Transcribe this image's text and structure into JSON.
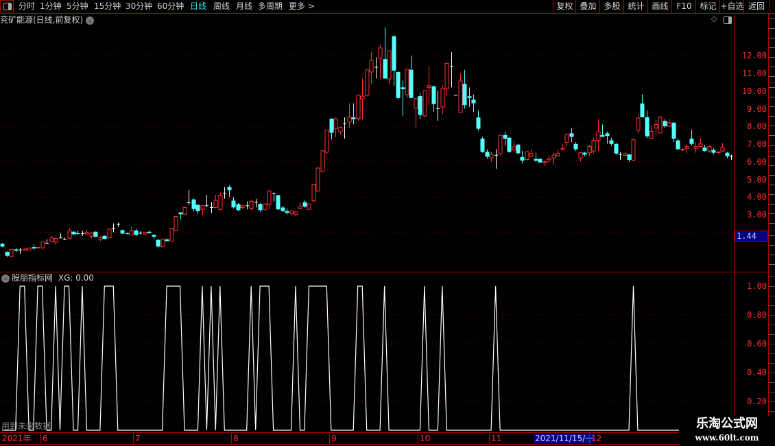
{
  "toolbar": {
    "periods": [
      "分时",
      "1分钟",
      "5分钟",
      "15分钟",
      "30分钟",
      "60分钟",
      "日线",
      "周线",
      "月线",
      "多周期",
      "更多 >"
    ],
    "active_period": "日线",
    "buttons": [
      "复权",
      "叠加",
      "多股",
      "统计",
      "画线",
      "F10",
      "标记",
      "+自选",
      "返回"
    ]
  },
  "main_chart": {
    "title": "兖矿能源(日线,前复权)",
    "price_ticks": [
      "12.00",
      "11.00",
      "10.00",
      "9.00",
      "8.00",
      "7.00",
      "6.00",
      "5.00",
      "4.00",
      "3.00"
    ],
    "crosshair_value": "1.44"
  },
  "indicator_panel": {
    "title": "股朋指标网",
    "value_label": "XG: 0.00",
    "ticks": [
      "1.00",
      "0.80",
      "0.60",
      "0.40",
      "0.20"
    ],
    "future_data_note": "用到未来数据"
  },
  "date_axis": {
    "year_label": "2021年",
    "months": [
      "6",
      "7",
      "8",
      "9",
      "10",
      "11",
      "12"
    ],
    "highlighted_date": "2021/11/15/一"
  },
  "watermark": {
    "title": "乐淘公式网",
    "url": "www.60lt.com"
  },
  "colors": {
    "up": "#ff3232",
    "down": "#54ffff",
    "doji": "#ffffff",
    "axis": "#b00000",
    "signal": "#ffffff",
    "active_tab": "#33e0f0"
  },
  "chart_data": [
    {
      "type": "candlestick",
      "title": "兖矿能源(日线,前复权)",
      "ylim": [
        0.5,
        13.6
      ],
      "grid": "dotted every 2.00",
      "ohlc_fields": [
        "open",
        "high",
        "low",
        "close"
      ],
      "ohlc": [
        [
          1.34,
          1.4,
          1.15,
          1.19
        ],
        [
          0.89,
          0.92,
          0.6,
          0.67
        ],
        [
          0.63,
          1.05,
          0.6,
          1.02
        ],
        [
          1.03,
          1.1,
          0.9,
          0.95
        ],
        [
          1.0,
          1.12,
          0.78,
          1.0
        ],
        [
          1.0,
          1.08,
          0.98,
          1.05
        ],
        [
          0.98,
          1.15,
          0.96,
          1.1
        ],
        [
          1.16,
          1.3,
          1.02,
          1.08
        ],
        [
          1.13,
          1.16,
          1.08,
          1.15
        ],
        [
          1.12,
          1.47,
          1.0,
          1.45
        ],
        [
          1.38,
          1.6,
          1.36,
          1.38
        ],
        [
          1.47,
          1.8,
          1.45,
          1.68
        ],
        [
          1.44,
          1.68,
          1.3,
          1.65
        ],
        [
          1.68,
          1.95,
          1.66,
          1.68
        ],
        [
          1.6,
          1.7,
          1.55,
          1.6
        ],
        [
          1.66,
          2.25,
          1.6,
          2.09
        ],
        [
          2.03,
          2.06,
          1.86,
          1.88
        ],
        [
          1.95,
          2.1,
          1.85,
          1.9
        ],
        [
          1.93,
          2.08,
          1.78,
          1.93
        ],
        [
          1.9,
          2.15,
          1.88,
          2.0
        ],
        [
          1.78,
          2.0,
          1.65,
          1.95
        ],
        [
          2.03,
          2.05,
          1.72,
          1.75
        ],
        [
          1.6,
          1.78,
          1.5,
          1.7
        ],
        [
          1.8,
          1.82,
          1.6,
          1.63
        ],
        [
          1.69,
          2.22,
          1.66,
          2.18
        ],
        [
          2.2,
          2.5,
          2.0,
          2.2
        ],
        [
          2.45,
          2.55,
          2.3,
          2.45
        ],
        [
          2.12,
          2.15,
          1.9,
          1.93
        ],
        [
          1.95,
          1.98,
          1.88,
          1.9
        ],
        [
          1.84,
          2.3,
          1.82,
          2.08
        ],
        [
          2.1,
          2.2,
          1.8,
          1.85
        ],
        [
          1.95,
          2.05,
          1.88,
          1.95
        ],
        [
          1.9,
          2.02,
          1.88,
          1.98
        ],
        [
          2.03,
          2.1,
          1.93,
          1.95
        ],
        [
          1.85,
          1.9,
          1.62,
          1.75
        ],
        [
          1.57,
          1.62,
          1.12,
          1.19
        ],
        [
          1.18,
          1.66,
          1.16,
          1.62
        ],
        [
          1.6,
          1.62,
          1.48,
          1.5
        ],
        [
          1.5,
          2.25,
          1.45,
          2.2
        ],
        [
          2.09,
          2.92,
          2.07,
          2.89
        ],
        [
          3.12,
          3.14,
          2.75,
          3.02
        ],
        [
          3.02,
          3.45,
          3.0,
          3.4
        ],
        [
          3.67,
          4.4,
          3.55,
          3.67
        ],
        [
          3.86,
          3.92,
          3.2,
          3.32
        ],
        [
          3.55,
          3.6,
          3.05,
          3.2
        ],
        [
          3.3,
          3.55,
          2.95,
          3.5
        ],
        [
          3.5,
          4.1,
          3.45,
          3.5
        ],
        [
          3.4,
          3.7,
          3.1,
          3.4
        ],
        [
          3.4,
          4.1,
          3.35,
          3.8
        ],
        [
          3.29,
          4.25,
          3.25,
          4.09
        ],
        [
          4.2,
          4.55,
          3.9,
          4.2
        ],
        [
          4.56,
          4.65,
          4.0,
          4.38
        ],
        [
          3.79,
          4.0,
          3.35,
          3.41
        ],
        [
          3.6,
          3.65,
          3.2,
          3.25
        ],
        [
          3.4,
          3.55,
          3.3,
          3.5
        ],
        [
          3.5,
          3.75,
          3.3,
          3.5
        ],
        [
          3.35,
          3.8,
          3.25,
          3.75
        ],
        [
          3.7,
          3.9,
          3.4,
          3.7
        ],
        [
          3.6,
          3.65,
          3.15,
          3.25
        ],
        [
          3.3,
          3.65,
          3.2,
          3.6
        ],
        [
          3.55,
          4.45,
          3.3,
          4.33
        ],
        [
          4.2,
          4.25,
          3.75,
          4.2
        ],
        [
          4.1,
          4.12,
          3.25,
          3.3
        ],
        [
          3.4,
          3.5,
          3.15,
          3.2
        ],
        [
          3.2,
          3.35,
          3.0,
          3.1
        ],
        [
          3.05,
          3.25,
          2.9,
          3.2
        ],
        [
          3.0,
          3.2,
          2.9,
          3.15
        ],
        [
          3.35,
          3.7,
          3.3,
          3.45
        ],
        [
          3.7,
          3.8,
          3.4,
          3.45
        ],
        [
          3.3,
          3.65,
          3.25,
          3.6
        ],
        [
          3.78,
          4.75,
          3.7,
          4.71
        ],
        [
          4.34,
          5.7,
          4.28,
          5.63
        ],
        [
          5.45,
          6.65,
          5.4,
          6.61
        ],
        [
          6.53,
          7.8,
          6.4,
          7.78
        ],
        [
          8.43,
          8.45,
          7.25,
          7.63
        ],
        [
          7.85,
          8.47,
          7.4,
          8.43
        ],
        [
          7.69,
          7.97,
          7.55,
          7.94
        ],
        [
          8.15,
          8.5,
          7.3,
          8.15
        ],
        [
          8.24,
          9.3,
          7.9,
          8.51
        ],
        [
          8.5,
          9.3,
          8.1,
          8.4
        ],
        [
          8.43,
          9.75,
          8.3,
          9.75
        ],
        [
          9.55,
          10.7,
          8.4,
          9.7
        ],
        [
          9.75,
          11.2,
          9.7,
          11.19
        ],
        [
          11.07,
          12.2,
          10.4,
          11.73
        ],
        [
          11.34,
          11.9,
          10.7,
          11.34
        ],
        [
          11.84,
          12.6,
          10.7,
          12.43
        ],
        [
          11.8,
          13.6,
          10.7,
          10.7
        ],
        [
          10.68,
          12.3,
          10.4,
          12.27
        ],
        [
          13.09,
          13.15,
          10.3,
          11.15
        ],
        [
          11.07,
          11.1,
          9.5,
          9.6
        ],
        [
          10.2,
          10.6,
          8.6,
          10.1
        ],
        [
          9.79,
          11.25,
          9.6,
          11.22
        ],
        [
          11.2,
          12.0,
          9.6,
          9.6
        ],
        [
          9.03,
          9.6,
          7.9,
          9.56
        ],
        [
          9.71,
          9.9,
          8.4,
          8.64
        ],
        [
          8.59,
          10.05,
          8.5,
          10.02
        ],
        [
          10.2,
          11.4,
          9.2,
          10.3
        ],
        [
          10.26,
          10.3,
          8.8,
          9.26
        ],
        [
          9.0,
          10.0,
          8.3,
          9.0
        ],
        [
          9.09,
          10.3,
          8.7,
          10.14
        ],
        [
          10.11,
          11.6,
          9.7,
          11.56
        ],
        [
          11.4,
          12.2,
          10.2,
          11.4
        ],
        [
          9.75,
          9.75,
          9.75,
          9.75
        ],
        [
          8.78,
          11.0,
          8.78,
          10.56
        ],
        [
          10.4,
          11.2,
          9.0,
          9.2
        ],
        [
          9.7,
          10.2,
          9.1,
          9.6
        ],
        [
          9.5,
          9.8,
          8.8,
          9.3
        ],
        [
          8.5,
          8.9,
          7.75,
          7.86
        ],
        [
          7.3,
          7.4,
          6.5,
          6.55
        ],
        [
          6.56,
          6.7,
          6.15,
          6.28
        ],
        [
          6.21,
          6.55,
          6.0,
          6.4
        ],
        [
          6.36,
          6.7,
          5.6,
          6.36
        ],
        [
          6.43,
          7.5,
          6.35,
          7.49
        ],
        [
          7.5,
          7.7,
          6.9,
          7.3
        ],
        [
          7.35,
          7.4,
          6.5,
          6.55
        ],
        [
          6.66,
          7.2,
          6.55,
          6.83
        ],
        [
          6.96,
          7.0,
          6.4,
          6.47
        ],
        [
          6.26,
          6.6,
          5.9,
          6.06
        ],
        [
          6.12,
          6.6,
          6.05,
          6.56
        ],
        [
          6.3,
          6.7,
          6.25,
          6.45
        ],
        [
          6.15,
          6.5,
          6.0,
          6.05
        ],
        [
          6.15,
          6.2,
          5.9,
          5.95
        ],
        [
          5.95,
          6.05,
          5.75,
          6.0
        ],
        [
          6.1,
          6.35,
          5.9,
          6.17
        ],
        [
          6.21,
          6.5,
          5.8,
          6.37
        ],
        [
          6.33,
          6.65,
          6.25,
          6.47
        ],
        [
          6.7,
          7.0,
          6.65,
          6.75
        ],
        [
          7.09,
          7.6,
          6.9,
          7.54
        ],
        [
          7.6,
          7.9,
          7.1,
          7.4
        ],
        [
          7.0,
          7.1,
          6.6,
          6.7
        ],
        [
          6.2,
          6.55,
          6.0,
          6.5
        ],
        [
          6.5,
          6.55,
          6.3,
          6.4
        ],
        [
          6.5,
          6.95,
          6.3,
          6.85
        ],
        [
          6.6,
          7.35,
          6.45,
          7.2
        ],
        [
          7.2,
          8.4,
          6.6,
          7.69
        ],
        [
          7.5,
          8.1,
          7.4,
          7.4
        ],
        [
          7.6,
          7.7,
          7.0,
          7.45
        ],
        [
          7.2,
          7.35,
          6.9,
          7.0
        ],
        [
          7.0,
          7.05,
          6.4,
          6.45
        ],
        [
          6.4,
          6.55,
          6.1,
          6.4
        ],
        [
          6.35,
          6.5,
          6.3,
          6.45
        ],
        [
          6.4,
          6.45,
          6.0,
          6.1
        ],
        [
          6.08,
          7.3,
          6.05,
          7.23
        ],
        [
          7.77,
          8.7,
          7.6,
          8.46
        ],
        [
          9.29,
          9.8,
          8.5,
          8.51
        ],
        [
          8.51,
          8.9,
          7.3,
          7.43
        ],
        [
          7.32,
          8.0,
          7.3,
          7.71
        ],
        [
          7.9,
          8.35,
          7.5,
          8.1
        ],
        [
          7.62,
          8.6,
          7.6,
          8.51
        ],
        [
          8.3,
          8.4,
          7.9,
          8.0
        ],
        [
          8.0,
          8.4,
          7.95,
          8.2
        ],
        [
          8.2,
          8.25,
          7.1,
          7.3
        ],
        [
          7.2,
          7.3,
          6.65,
          6.7
        ],
        [
          6.65,
          6.75,
          6.6,
          6.7
        ],
        [
          6.75,
          7.0,
          6.45,
          6.85
        ],
        [
          7.3,
          7.8,
          6.9,
          7.0
        ],
        [
          6.75,
          7.1,
          6.5,
          6.85
        ],
        [
          6.85,
          7.3,
          6.8,
          7.0
        ],
        [
          6.8,
          6.95,
          6.55,
          6.6
        ],
        [
          6.6,
          6.9,
          6.5,
          6.85
        ],
        [
          6.65,
          6.75,
          6.4,
          6.5
        ],
        [
          6.5,
          6.55,
          6.45,
          6.55
        ],
        [
          6.6,
          7.05,
          6.55,
          6.8
        ],
        [
          6.5,
          6.55,
          6.2,
          6.3
        ],
        [
          6.3,
          6.4,
          6.1,
          6.3
        ]
      ]
    },
    {
      "type": "line",
      "series_name": "XG",
      "ylim": [
        0,
        1
      ],
      "grid": "dotted every 0.20",
      "value_one_ranges": [
        [
          4,
          5
        ],
        [
          8,
          9
        ],
        [
          12,
          12
        ],
        [
          14,
          15
        ],
        [
          18,
          18
        ],
        [
          23,
          25
        ],
        [
          37,
          40
        ],
        [
          45,
          45
        ],
        [
          47,
          47
        ],
        [
          49,
          49
        ],
        [
          56,
          56
        ],
        [
          58,
          60
        ],
        [
          66,
          66
        ],
        [
          69,
          73
        ],
        [
          80,
          81
        ],
        [
          86,
          86
        ],
        [
          95,
          95
        ],
        [
          99,
          99
        ],
        [
          111,
          111
        ],
        [
          142,
          142
        ]
      ],
      "other_value": 0
    }
  ]
}
